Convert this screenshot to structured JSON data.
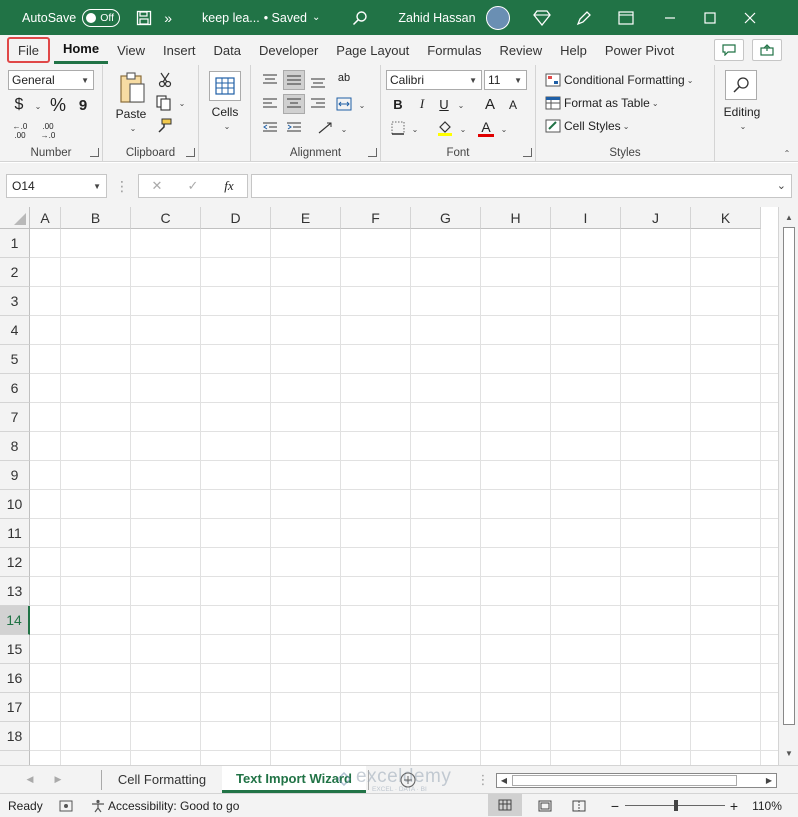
{
  "titlebar": {
    "autosave_label": "AutoSave",
    "autosave_state": "Off",
    "doc_title": "keep lea...",
    "saved_status": "• Saved",
    "user_name": "Zahid Hassan",
    "more_symbol": "»"
  },
  "tabs": [
    "File",
    "Home",
    "View",
    "Insert",
    "Data",
    "Developer",
    "Page Layout",
    "Formulas",
    "Review",
    "Help",
    "Power Pivot"
  ],
  "ribbon": {
    "number": {
      "format_value": "General",
      "currency": "$",
      "percent": "%",
      "comma": "9",
      "inc_decimal": "←.0 .00",
      "dec_decimal": ".00 →.0",
      "label": "Number"
    },
    "clipboard": {
      "paste_label": "Paste",
      "label": "Clipboard"
    },
    "cells": {
      "label": "Cells"
    },
    "alignment": {
      "label": "Alignment",
      "wrap": "ab"
    },
    "font": {
      "font_name": "Calibri",
      "font_size": "11",
      "bold": "B",
      "italic": "I",
      "underline": "U",
      "grow": "A",
      "shrink": "A",
      "font_color": "A",
      "label": "Font"
    },
    "styles": {
      "conditional": "Conditional Formatting",
      "format_table": "Format as Table",
      "cell_styles": "Cell Styles",
      "label": "Styles"
    },
    "editing": {
      "label": "Editing"
    }
  },
  "formula_bar": {
    "name_box": "O14",
    "cancel": "✕",
    "enter": "✓",
    "fx": "fx",
    "formula_value": ""
  },
  "grid": {
    "columns": [
      "A",
      "B",
      "C",
      "D",
      "E",
      "F",
      "G",
      "H",
      "I",
      "J",
      "K"
    ],
    "rows": [
      "1",
      "2",
      "3",
      "4",
      "5",
      "6",
      "7",
      "8",
      "9",
      "10",
      "11",
      "12",
      "13",
      "14",
      "15",
      "16",
      "17",
      "18"
    ],
    "selected_row": "14"
  },
  "sheets": {
    "tabs": [
      "Cell Formatting",
      "Text Import Wizard"
    ],
    "active": "Text Import Wizard",
    "watermark": "exceldemy",
    "watermark_sub": "EXCEL · DATA · BI"
  },
  "statusbar": {
    "ready": "Ready",
    "accessibility": "Accessibility: Good to go",
    "zoom": "110%"
  },
  "colors": {
    "excel_green": "#217346",
    "file_highlight": "#e04848"
  }
}
